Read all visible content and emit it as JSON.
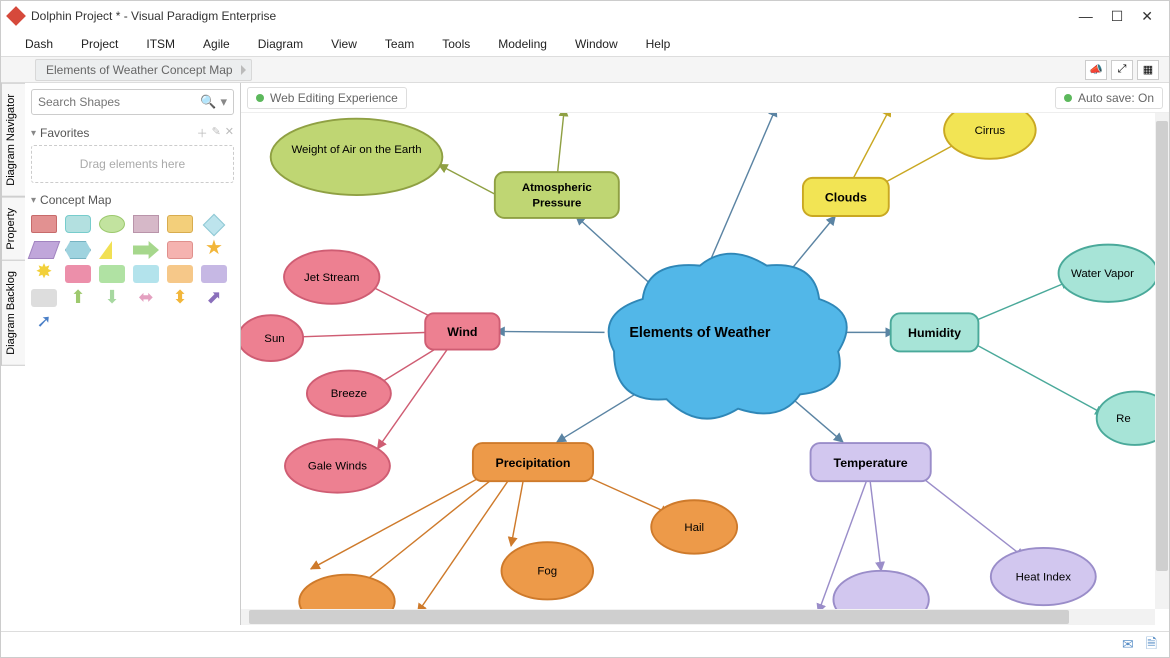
{
  "window": {
    "title": "Dolphin Project * - Visual Paradigm Enterprise"
  },
  "menu": [
    "Dash",
    "Project",
    "ITSM",
    "Agile",
    "Diagram",
    "View",
    "Team",
    "Tools",
    "Modeling",
    "Window",
    "Help"
  ],
  "breadcrumb": "Elements of Weather Concept Map",
  "sidebar": {
    "search_placeholder": "Search Shapes",
    "favorites_label": "Favorites",
    "dropzone_text": "Drag elements here",
    "palette_label": "Concept Map"
  },
  "vtabs": [
    "Diagram Navigator",
    "Property",
    "Diagram Backlog"
  ],
  "canvas": {
    "left_chip": "Web Editing Experience",
    "right_chip": "Auto save: On"
  },
  "nodes": {
    "center": "Elements of Weather",
    "atm": "Atmospheric Pressure",
    "weight": "Weight of Air on the Earth",
    "clouds": "Clouds",
    "cirrus": "Cirrus",
    "humidity": "Humidity",
    "vapor": "Water Vapor",
    "re": "Re",
    "temperature": "Temperature",
    "heatindex": "Heat Index",
    "precipitation": "Precipitation",
    "hail": "Hail",
    "fog": "Fog",
    "wind": "Wind",
    "jet": "Jet Stream",
    "sun": "Sun",
    "breeze": "Breeze",
    "gale": "Gale Winds"
  }
}
